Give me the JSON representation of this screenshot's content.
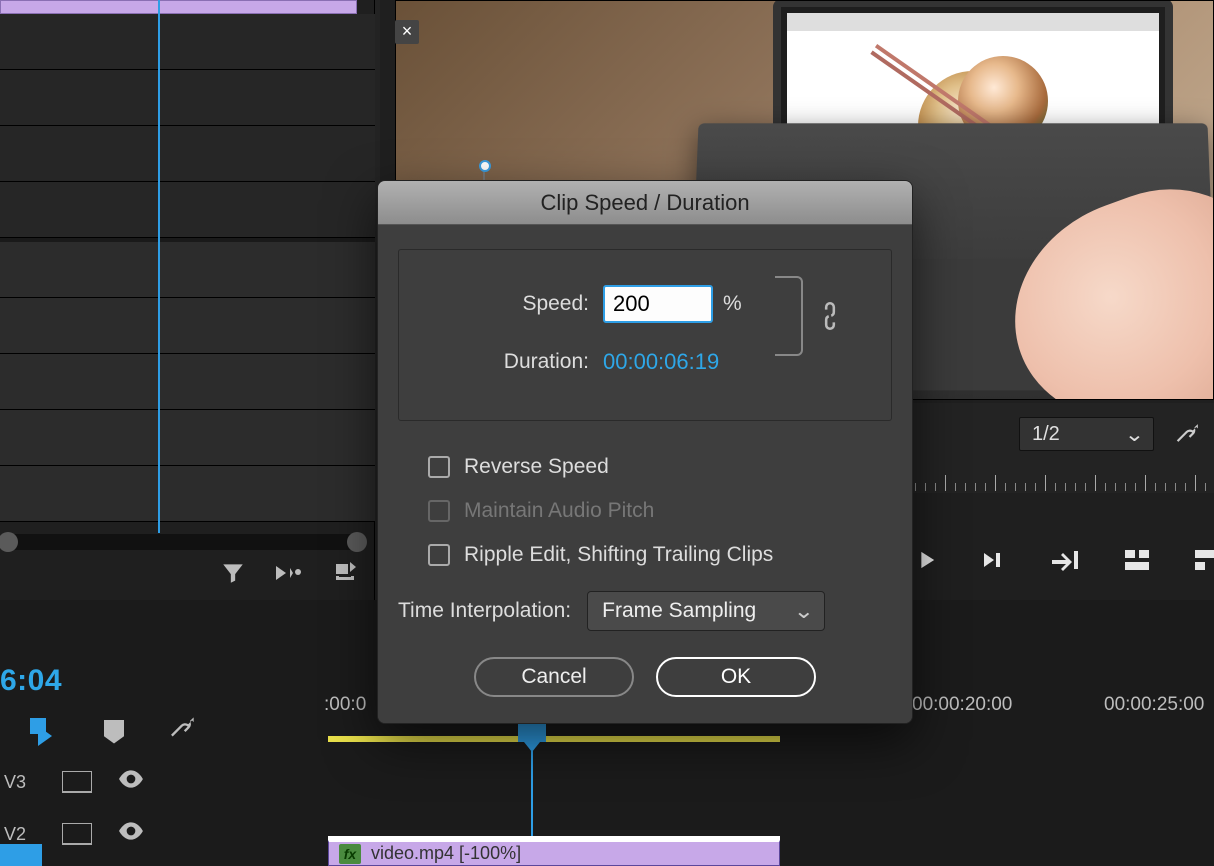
{
  "top_clip": {
    "label": "video.mp4"
  },
  "monitor": {
    "tab_close": "×",
    "zoom": "1/2",
    "wrench_icon": "wrench-icon"
  },
  "dialog": {
    "title": "Clip Speed / Duration",
    "speed_label": "Speed:",
    "speed_value": "200",
    "percent": "%",
    "duration_label": "Duration:",
    "duration_value": "00:00:06:19",
    "link_icon": "link-icon",
    "reverse": "Reverse Speed",
    "maintain": "Maintain Audio Pitch",
    "ripple": "Ripple Edit, Shifting Trailing Clips",
    "interp_label": "Time Interpolation:",
    "interp_value": "Frame Sampling",
    "cancel": "Cancel",
    "ok": "OK"
  },
  "timeline": {
    "current_time": "6:04",
    "ruler": [
      ":00:0",
      "00:00:20:00",
      "00:00:25:00"
    ],
    "v3": "V3",
    "v2": "V2",
    "clip_label": "video.mp4 [-100%]"
  },
  "transport": {
    "play_icon": "play-icon",
    "stepfw_icon": "step-forward-icon",
    "jump_icon": "jump-icon",
    "insert_icon": "insert-icon",
    "overwrite_icon": "overwrite-icon"
  }
}
